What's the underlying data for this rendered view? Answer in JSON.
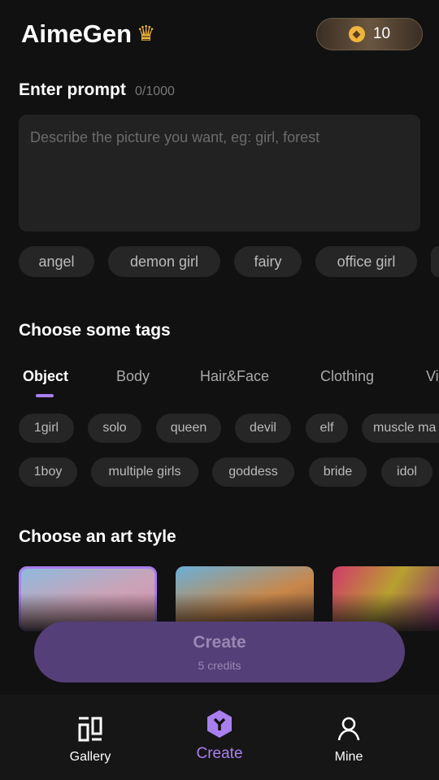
{
  "header": {
    "title": "AimeGen",
    "crown_icon": "crown-icon",
    "credits": "10"
  },
  "prompt": {
    "label": "Enter prompt",
    "count": "0/1000",
    "placeholder": "Describe the picture you want, eg: girl, forest",
    "value": "",
    "examples": [
      "angel",
      "demon girl",
      "fairy",
      "office girl"
    ]
  },
  "tags": {
    "label": "Choose some tags",
    "tabs": [
      "Object",
      "Body",
      "Hair&Face",
      "Clothing",
      "Vi"
    ],
    "active_tab": "Object",
    "row1": [
      "1girl",
      "solo",
      "queen",
      "devil",
      "elf",
      "muscle ma"
    ],
    "row2": [
      "1boy",
      "multiple girls",
      "goddess",
      "bride",
      "idol"
    ]
  },
  "art_style": {
    "label": "Choose an art style"
  },
  "create": {
    "label": "Create",
    "cost": "5 credits"
  },
  "nav": {
    "items": [
      {
        "label": "Gallery"
      },
      {
        "label": "Create"
      },
      {
        "label": "Mine"
      }
    ],
    "active": "Create"
  },
  "colors": {
    "accent": "#a97ff0",
    "button": "#553f78",
    "bg": "#111111",
    "chip": "#262626"
  }
}
